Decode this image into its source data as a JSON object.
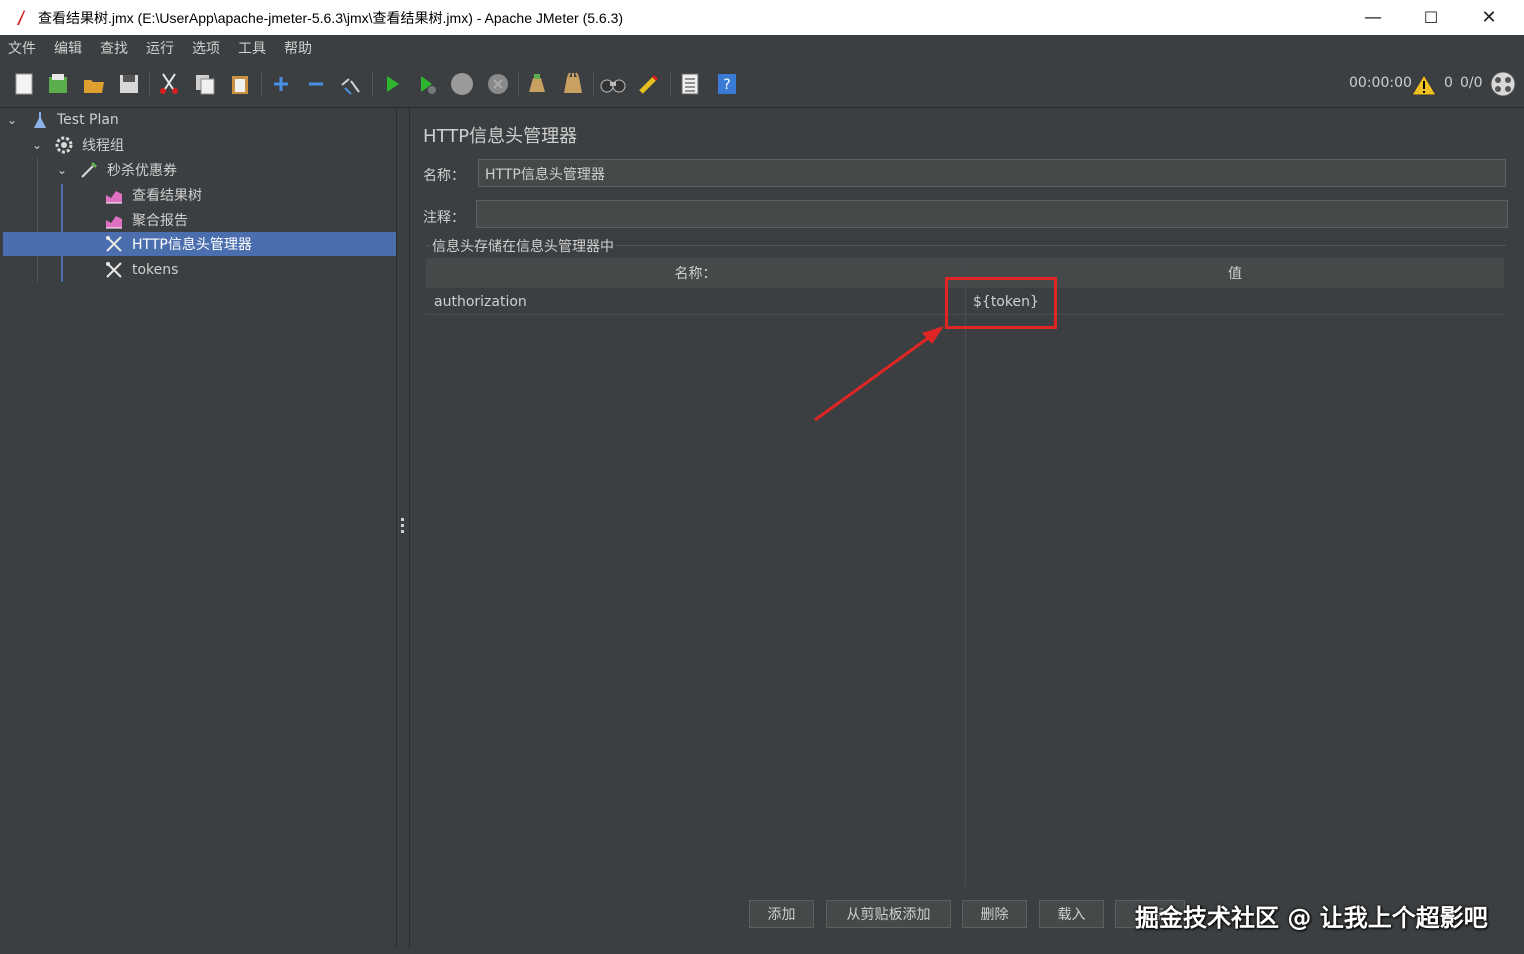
{
  "window": {
    "title": "查看结果树.jmx (E:\\UserApp\\apache-jmeter-5.6.3\\jmx\\查看结果树.jmx) - Apache JMeter (5.6.3)",
    "minimize": "—",
    "maximize": "☐",
    "close": "✕"
  },
  "menu": [
    "文件",
    "编辑",
    "查找",
    "运行",
    "选项",
    "工具",
    "帮助"
  ],
  "status": {
    "elapsed": "00:00:00",
    "warnings": "0",
    "threads": "0/0"
  },
  "tree": [
    {
      "label": "Test Plan",
      "icon": "test-plan-icon",
      "level": 0,
      "expanded": true
    },
    {
      "label": "线程组",
      "icon": "gear-icon",
      "level": 1,
      "expanded": true
    },
    {
      "label": "秒杀优惠券",
      "icon": "pipette-icon",
      "level": 2,
      "expanded": true
    },
    {
      "label": "查看结果树",
      "icon": "chart-icon",
      "level": 3
    },
    {
      "label": "聚合报告",
      "icon": "chart-icon",
      "level": 3
    },
    {
      "label": "HTTP信息头管理器",
      "icon": "tools-icon",
      "level": 3,
      "selected": true
    },
    {
      "label": "tokens",
      "icon": "tools-icon",
      "level": 3
    }
  ],
  "panel": {
    "title": "HTTP信息头管理器",
    "name_label": "名称：",
    "name_value": "HTTP信息头管理器",
    "comment_label": "注释：",
    "comment_value": "",
    "group_title": "信息头存储在信息头管理器中",
    "columns": [
      "名称：",
      "值"
    ],
    "rows": [
      {
        "name": "authorization",
        "value": "${token}"
      }
    ]
  },
  "buttons": {
    "add": "添加",
    "add_from_clipboard": "从剪贴板添加",
    "delete": "删除",
    "load": "载入",
    "save": "保存"
  },
  "watermark": "掘金技术社区 @ 让我上个超影吧",
  "colors": {
    "background": "#3c3f41",
    "selection": "#4b6eaf",
    "highlight": "#e02525"
  }
}
